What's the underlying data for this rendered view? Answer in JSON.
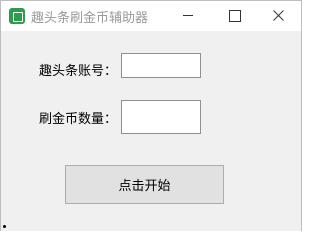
{
  "window": {
    "title": "趣头条刷金币辅助器",
    "icon": "app-icon",
    "controls": [
      "minimize-icon",
      "maximize-icon",
      "close-icon"
    ]
  },
  "form": {
    "account_label": "趣头条账号：",
    "account_value": "",
    "coins_label": "刷金币数量：",
    "coins_value": ""
  },
  "actions": {
    "start_label": "点击开始"
  }
}
